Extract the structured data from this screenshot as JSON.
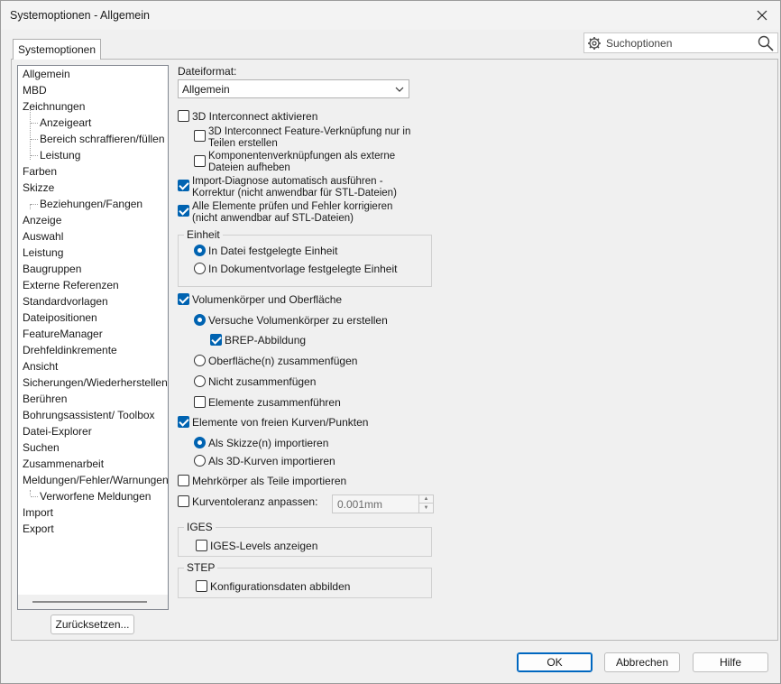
{
  "window": {
    "title": "Systemoptionen - Allgemein"
  },
  "tab": {
    "label": "Systemoptionen"
  },
  "search": {
    "placeholder": "Suchoptionen"
  },
  "tree": {
    "items": [
      {
        "label": "Allgemein"
      },
      {
        "label": "MBD"
      },
      {
        "label": "Zeichnungen"
      },
      {
        "label": "Anzeigeart"
      },
      {
        "label": "Bereich schraffieren/füllen"
      },
      {
        "label": "Leistung"
      },
      {
        "label": "Farben"
      },
      {
        "label": "Skizze"
      },
      {
        "label": "Beziehungen/Fangen"
      },
      {
        "label": "Anzeige"
      },
      {
        "label": "Auswahl"
      },
      {
        "label": "Leistung"
      },
      {
        "label": "Baugruppen"
      },
      {
        "label": "Externe Referenzen"
      },
      {
        "label": "Standardvorlagen"
      },
      {
        "label": "Dateipositionen"
      },
      {
        "label": "FeatureManager"
      },
      {
        "label": "Drehfeldinkremente"
      },
      {
        "label": "Ansicht"
      },
      {
        "label": "Sicherungen/Wiederherstellen"
      },
      {
        "label": "Berühren"
      },
      {
        "label": "Bohrungsassistent/ Toolbox"
      },
      {
        "label": "Datei-Explorer"
      },
      {
        "label": "Suchen"
      },
      {
        "label": "Zusammenarbeit"
      },
      {
        "label": "Meldungen/Fehler/Warnungen"
      },
      {
        "label": "Verworfene Meldungen"
      },
      {
        "label": "Import"
      },
      {
        "label": "Export"
      }
    ],
    "selected": "Import"
  },
  "reset_button": "Zurücksetzen...",
  "options": {
    "dateiformat_label": "Dateiformat:",
    "dateiformat_value": "Allgemein",
    "interconnect": "3D Interconnect aktivieren",
    "interconnect_feature_1": "3D Interconnect Feature-Verknüpfung nur in",
    "interconnect_feature_2": "Teilen erstellen",
    "komponenten_1": "Komponentenverknüpfungen als externe",
    "komponenten_2": "Dateien aufheben",
    "importdiag_1": "Import-Diagnose automatisch ausführen -",
    "importdiag_2": "Korrektur (nicht anwendbar für STL-Dateien)",
    "pruefen_1": "Alle Elemente prüfen und Fehler korrigieren",
    "pruefen_2": "(nicht anwendbar auf STL-Dateien)",
    "einheit_title": "Einheit",
    "einheit_datei": "In Datei festgelegte Einheit",
    "einheit_vorlage": "In Dokumentvorlage festgelegte Einheit",
    "volumen": "Volumenkörper und Oberfläche",
    "versuche": "Versuche Volumenkörper zu erstellen",
    "brep": "BREP-Abbildung",
    "oberflaeche": "Oberfläche(n) zusammenfügen",
    "nicht": "Nicht zusammenfügen",
    "elemente_zus": "Elemente zusammenführen",
    "freie_kurven": "Elemente von freien Kurven/Punkten",
    "als_skizze": "Als Skizze(n) importieren",
    "als_3d": "Als 3D-Kurven importieren",
    "mehrkoerper": "Mehrkörper als Teile importieren",
    "kurventol": "Kurventoleranz anpassen:",
    "kurventol_value": "0.001mm",
    "iges_title": "IGES",
    "iges_levels": "IGES-Levels anzeigen",
    "step_title": "STEP",
    "konfig": "Konfigurationsdaten abbilden"
  },
  "footer": {
    "ok": "OK",
    "cancel": "Abbrechen",
    "help": "Hilfe"
  },
  "colors": {
    "accent": "#0063b1"
  }
}
